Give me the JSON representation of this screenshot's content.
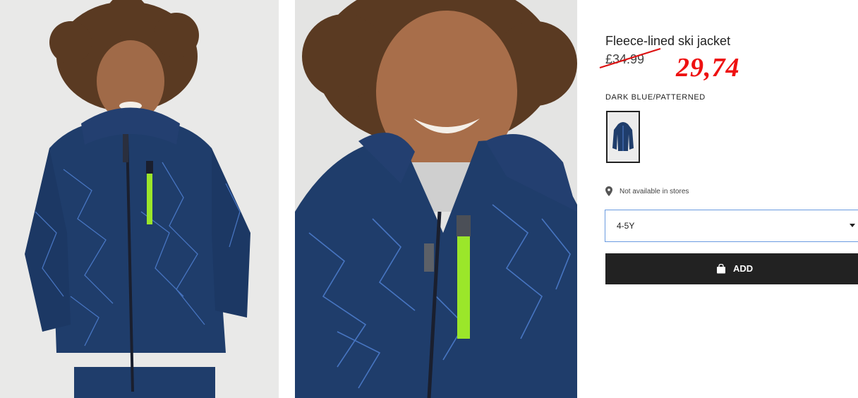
{
  "product": {
    "title": "Fleece-lined ski jacket",
    "old_price": "£34.99",
    "new_price": "29,74",
    "color_label": "DARK BLUE/PATTERNED"
  },
  "availability": {
    "store_text": "Not available in stores",
    "icon": "location-pin-icon"
  },
  "size_select": {
    "selected": "4-5Y"
  },
  "add_button": {
    "label": "ADD",
    "icon": "shopping-bag-icon"
  },
  "colors": {
    "jacket": "#1f3d6b",
    "pattern": "#4f7fd0",
    "zip_accent": "#9be62a",
    "new_price": "#ee1111",
    "button_bg": "#222222",
    "select_border": "#6a9be0"
  }
}
